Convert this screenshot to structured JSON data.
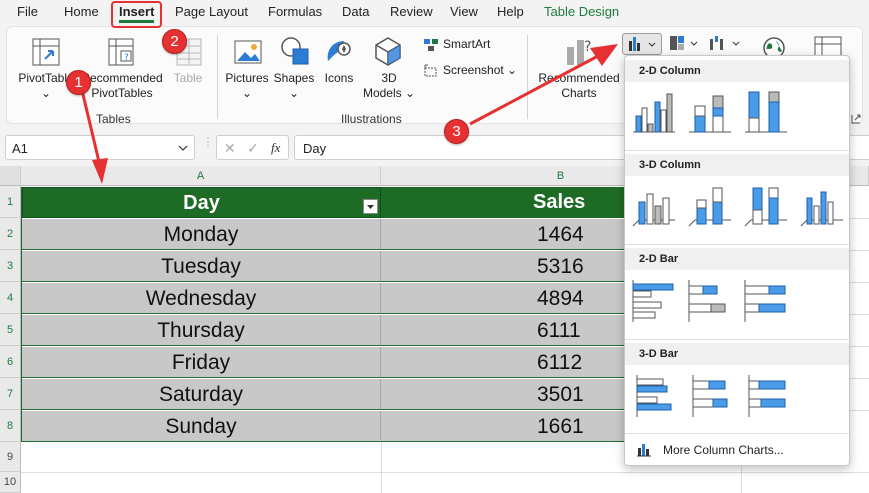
{
  "menu": [
    "File",
    "Home",
    "Insert",
    "Page Layout",
    "Formulas",
    "Data",
    "Review",
    "View",
    "Help",
    "Table Design"
  ],
  "ribbon": {
    "pivot_table": "PivotTable",
    "recommended_pivot_line1": "Recommended",
    "recommended_pivot_line2": "PivotTables",
    "table": "Table",
    "tables_group": "Tables",
    "pictures": "Pictures",
    "shapes": "Shapes",
    "icons": "Icons",
    "models_line1": "3D",
    "models_line2": "Models",
    "smartart": "SmartArt",
    "screenshot": "Screenshot",
    "illustrations_group": "Illustrations",
    "recommended_charts_line1": "Recommended",
    "recommended_charts_line2": "Charts"
  },
  "formula_bar": {
    "name_box": "A1",
    "cancel_glyph": "✕",
    "enter_glyph": "✓",
    "fx_glyph": "fx",
    "formula": "Day"
  },
  "columns": [
    "A",
    "B"
  ],
  "rows": [
    "1",
    "2",
    "3",
    "4",
    "5",
    "6",
    "7",
    "8",
    "9",
    "10"
  ],
  "table": {
    "headers": [
      "Day",
      "Sales"
    ],
    "body": [
      [
        "Monday",
        "1464"
      ],
      [
        "Tuesday",
        "5316"
      ],
      [
        "Wednesday",
        "4894"
      ],
      [
        "Thursday",
        "6111"
      ],
      [
        "Friday",
        "6112"
      ],
      [
        "Saturday",
        "3501"
      ],
      [
        "Sunday",
        "1661"
      ]
    ]
  },
  "dropdown": {
    "sections": [
      "2-D Column",
      "3-D Column",
      "2-D Bar",
      "3-D Bar"
    ],
    "more": "More Column Charts..."
  },
  "callouts": [
    "1",
    "2",
    "3"
  ],
  "colors": {
    "accent_green": "#1e7a3c",
    "table_header": "#1e6b26",
    "table_body": "#c8c8c8",
    "callout_red": "#e53131",
    "chart_blue": "#4a9be8"
  }
}
